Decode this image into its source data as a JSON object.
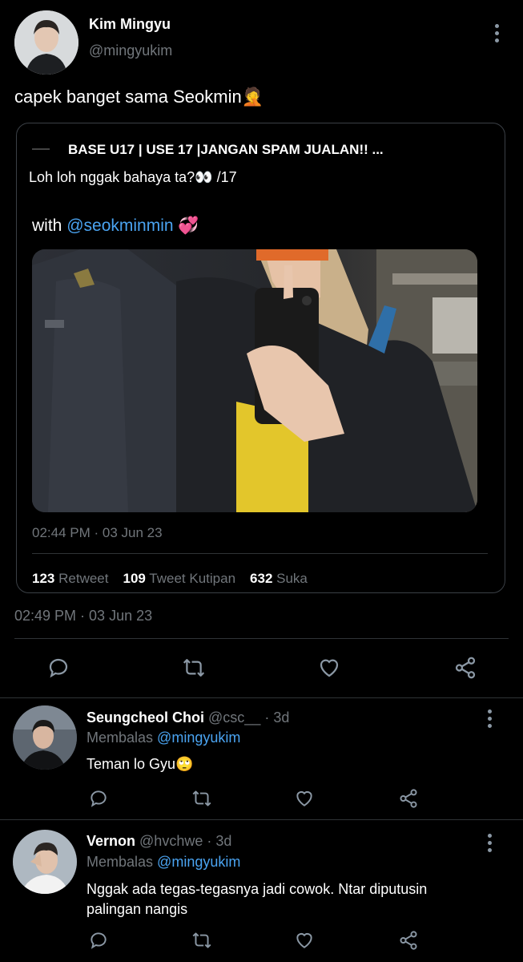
{
  "tweet": {
    "author_name": "Kim Mingyu",
    "author_handle": "@mingyukim",
    "text": "capek banget sama Seokmin",
    "emoji": "🤦",
    "timestamp": "02:49 PM · 03 Jun 23"
  },
  "quoted": {
    "source_name": "BASE U17 | USE 17 |JANGAN SPAM JUALAN!! ...",
    "text": "Loh loh nggak bahaya ta?👀 /17",
    "with_prefix": "with",
    "mention": "@seokminmin",
    "mention_emoji": "💞",
    "timestamp": "02:44 PM · 03 Jun 23",
    "stats": [
      {
        "count": "123",
        "label": "Retweet"
      },
      {
        "count": "109",
        "label": "Tweet Kutipan"
      },
      {
        "count": "632",
        "label": "Suka"
      }
    ]
  },
  "replies": [
    {
      "name": "Seungcheol Choi",
      "handle": "@csc__",
      "time": "· 3d",
      "replying_prefix": "Membalas",
      "replying_to": "@mingyukim",
      "text": "Teman lo Gyu🙄"
    },
    {
      "name": "Vernon",
      "handle": "@hvchwe",
      "time": "· 3d",
      "replying_prefix": "Membalas",
      "replying_to": "@mingyukim",
      "text_line1": "Nggak ada tegas-tegasnya jadi cowok. Ntar diputusin",
      "text_line2": "palingan nangis"
    }
  ],
  "colors": {
    "background": "#000000",
    "link": "#4aa3f0",
    "muted": "#71767b"
  }
}
